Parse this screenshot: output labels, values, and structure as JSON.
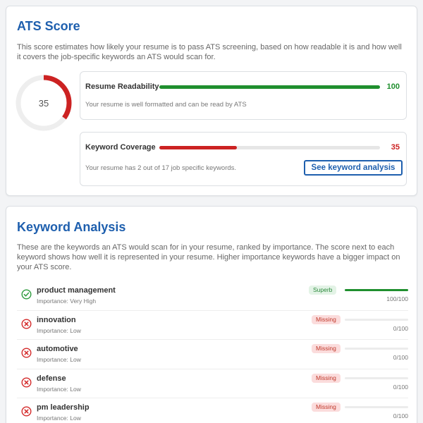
{
  "colors": {
    "accent": "#1e5fae",
    "success": "#1f8f2e",
    "danger": "#cc2222",
    "track": "#e6e6e6"
  },
  "ats": {
    "title": "ATS Score",
    "description": "This score estimates how likely your resume is to pass ATS screening, based on how readable it is and how well it covers the job-specific keywords an ATS would scan for.",
    "score": 35,
    "score_label": "35",
    "readability": {
      "label": "Resume Readability",
      "value": 100,
      "value_label": "100",
      "note": "Your resume is well formatted and can be read by ATS"
    },
    "coverage": {
      "label": "Keyword Coverage",
      "value": 35,
      "value_label": "35",
      "note": "Your resume has 2 out of 17 job specific keywords.",
      "button_label": "See keyword analysis"
    }
  },
  "keyword_analysis": {
    "title": "Keyword Analysis",
    "description": "These are the keywords an ATS would scan for in your resume, ranked by importance. The score next to each keyword shows how well it is represented in your resume. Higher importance keywords have a bigger impact on your ATS score.",
    "keywords": [
      {
        "name": "product management",
        "importance": "Importance: Very High",
        "status": "Superb",
        "found": true,
        "score": 100,
        "score_label": "100/100",
        "icon": "check-circle-icon"
      },
      {
        "name": "innovation",
        "importance": "Importance: Low",
        "status": "Missing",
        "found": false,
        "score": 0,
        "score_label": "0/100",
        "icon": "x-circle-icon"
      },
      {
        "name": "automotive",
        "importance": "Importance: Low",
        "status": "Missing",
        "found": false,
        "score": 0,
        "score_label": "0/100",
        "icon": "x-circle-icon"
      },
      {
        "name": "defense",
        "importance": "Importance: Low",
        "status": "Missing",
        "found": false,
        "score": 0,
        "score_label": "0/100",
        "icon": "x-circle-icon"
      },
      {
        "name": "pm leadership",
        "importance": "Importance: Low",
        "status": "Missing",
        "found": false,
        "score": 0,
        "score_label": "0/100",
        "icon": "x-circle-icon"
      }
    ]
  }
}
